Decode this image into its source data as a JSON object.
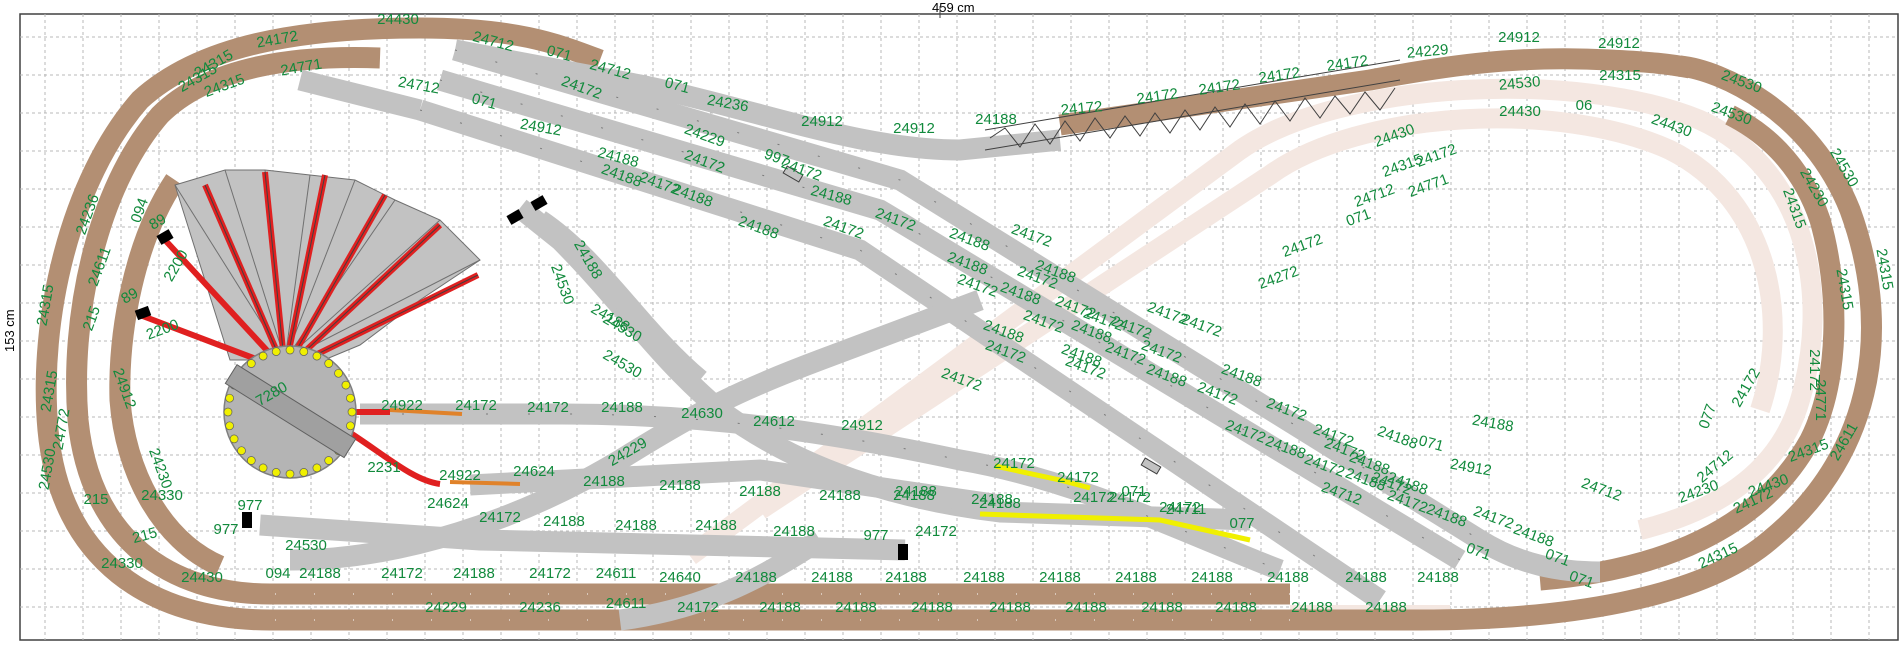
{
  "dimensions": {
    "width_label": "459 cm",
    "height_label": "153 cm"
  },
  "colors": {
    "grid": "#b9b9b9",
    "track_brown": "#b38f73",
    "track_gray": "#c2c2c2",
    "track_ghost": "#f4e7e1",
    "label_green": "#118a3c",
    "rail_red": "#e02020",
    "rail_yellow": "#f0f000",
    "turntable_light": "#b4b4b4"
  },
  "labels": [
    {
      "id": "a1",
      "text": "24430"
    },
    {
      "id": "a2",
      "text": "24712"
    },
    {
      "id": "a3",
      "text": "071"
    },
    {
      "id": "a4",
      "text": "24712"
    },
    {
      "id": "a5",
      "text": "071"
    },
    {
      "id": "a6",
      "text": "24236"
    },
    {
      "id": "a7",
      "text": "24912"
    },
    {
      "id": "a8",
      "text": "24912"
    },
    {
      "id": "a9",
      "text": "24188"
    },
    {
      "id": "a10",
      "text": "24172"
    },
    {
      "id": "a11",
      "text": "24172"
    },
    {
      "id": "a12",
      "text": "24172"
    },
    {
      "id": "a13",
      "text": "24172"
    },
    {
      "id": "a14",
      "text": "24172"
    },
    {
      "id": "a15",
      "text": "24229"
    },
    {
      "id": "a16",
      "text": "24912"
    },
    {
      "id": "a17",
      "text": "24912"
    },
    {
      "id": "a18",
      "text": "24530"
    },
    {
      "id": "a19",
      "text": "24315"
    },
    {
      "id": "a20",
      "text": "24530"
    },
    {
      "id": "a21",
      "text": "24430"
    },
    {
      "id": "a22",
      "text": "06"
    },
    {
      "id": "a23",
      "text": "24430"
    },
    {
      "id": "a24",
      "text": "24530"
    },
    {
      "id": "a25",
      "text": "24530"
    },
    {
      "id": "a26",
      "text": "24230"
    },
    {
      "id": "a27",
      "text": "24315"
    },
    {
      "id": "a28",
      "text": "24315"
    },
    {
      "id": "a29",
      "text": "24315"
    },
    {
      "id": "a30",
      "text": "24172"
    },
    {
      "id": "a31",
      "text": "24771"
    },
    {
      "id": "a32",
      "text": "24315"
    },
    {
      "id": "a33",
      "text": "24430"
    },
    {
      "id": "a34",
      "text": "24172"
    },
    {
      "id": "a35",
      "text": "24315"
    },
    {
      "id": "a36",
      "text": "24230"
    },
    {
      "id": "a37",
      "text": "24712"
    },
    {
      "id": "a38",
      "text": "24611"
    },
    {
      "id": "a39",
      "text": "077"
    },
    {
      "id": "a40",
      "text": "24172"
    },
    {
      "id": "b1",
      "text": "24315"
    },
    {
      "id": "b2",
      "text": "24172"
    },
    {
      "id": "b3",
      "text": "24315"
    },
    {
      "id": "b4",
      "text": "24315"
    },
    {
      "id": "b5",
      "text": "24771"
    },
    {
      "id": "b6",
      "text": "24712"
    },
    {
      "id": "b7",
      "text": "071"
    },
    {
      "id": "b8",
      "text": "24912"
    },
    {
      "id": "b9",
      "text": "24172"
    },
    {
      "id": "b10",
      "text": "24188"
    },
    {
      "id": "b11",
      "text": "24229"
    },
    {
      "id": "b12",
      "text": "997"
    },
    {
      "id": "b13",
      "text": "24188"
    },
    {
      "id": "b14",
      "text": "24172"
    },
    {
      "id": "b15",
      "text": "24172"
    },
    {
      "id": "b16",
      "text": "24188"
    },
    {
      "id": "b17",
      "text": "24188"
    },
    {
      "id": "b18",
      "text": "24172"
    },
    {
      "id": "b19",
      "text": "24188"
    },
    {
      "id": "b20",
      "text": "24172"
    },
    {
      "id": "b21",
      "text": "24172"
    },
    {
      "id": "b22",
      "text": "24188"
    },
    {
      "id": "b23",
      "text": "24172"
    },
    {
      "id": "b24",
      "text": "24188"
    },
    {
      "id": "b25",
      "text": "24172"
    },
    {
      "id": "b26",
      "text": "24188"
    },
    {
      "id": "b27",
      "text": "24172"
    },
    {
      "id": "b28",
      "text": "24172"
    },
    {
      "id": "b29",
      "text": "24188"
    },
    {
      "id": "b30",
      "text": "24172"
    },
    {
      "id": "b31",
      "text": "24172"
    },
    {
      "id": "b32",
      "text": "24188"
    },
    {
      "id": "b33",
      "text": "24172"
    },
    {
      "id": "b34",
      "text": "24188"
    },
    {
      "id": "b35",
      "text": "24172"
    },
    {
      "id": "b36",
      "text": "24188"
    },
    {
      "id": "b37",
      "text": "24172"
    },
    {
      "id": "b38",
      "text": "24188"
    },
    {
      "id": "b39",
      "text": "071"
    },
    {
      "id": "b40",
      "text": "071"
    },
    {
      "id": "b41",
      "text": "24912"
    },
    {
      "id": "b42",
      "text": "24188"
    },
    {
      "id": "b43",
      "text": "24712"
    },
    {
      "id": "b44",
      "text": "24172"
    },
    {
      "id": "b45",
      "text": "24172"
    },
    {
      "id": "b46",
      "text": "071"
    },
    {
      "id": "b47",
      "text": "24188"
    },
    {
      "id": "b48",
      "text": "24712"
    },
    {
      "id": "b49",
      "text": "24188"
    },
    {
      "id": "b50",
      "text": "24172"
    },
    {
      "id": "b51",
      "text": "24188"
    },
    {
      "id": "b52",
      "text": "24172"
    },
    {
      "id": "b53",
      "text": "24172"
    },
    {
      "id": "b54",
      "text": "24172"
    },
    {
      "id": "b55",
      "text": "24172"
    },
    {
      "id": "b56",
      "text": "24172"
    },
    {
      "id": "b57",
      "text": "24188"
    },
    {
      "id": "b58",
      "text": "24172"
    },
    {
      "id": "b59",
      "text": "24172"
    },
    {
      "id": "b60",
      "text": "24188"
    },
    {
      "id": "b61",
      "text": "24172"
    },
    {
      "id": "b62",
      "text": "24172"
    },
    {
      "id": "b63",
      "text": "24188"
    },
    {
      "id": "b64",
      "text": "24172"
    },
    {
      "id": "b65",
      "text": "24172"
    },
    {
      "id": "b66",
      "text": "24188"
    },
    {
      "id": "b67",
      "text": "24188"
    },
    {
      "id": "b68",
      "text": "071"
    },
    {
      "id": "c1",
      "text": "24172"
    },
    {
      "id": "c2",
      "text": "24430"
    },
    {
      "id": "c3",
      "text": "24315"
    },
    {
      "id": "c4",
      "text": "24771"
    },
    {
      "id": "c5",
      "text": "24712"
    },
    {
      "id": "c6",
      "text": "071"
    },
    {
      "id": "c7",
      "text": "24172"
    },
    {
      "id": "c8",
      "text": "24272"
    },
    {
      "id": "c9",
      "text": "24236"
    },
    {
      "id": "c10",
      "text": "094"
    },
    {
      "id": "c11",
      "text": "24611"
    },
    {
      "id": "c12",
      "text": "215"
    },
    {
      "id": "c13",
      "text": "24315"
    },
    {
      "id": "c14",
      "text": "24315"
    },
    {
      "id": "c15",
      "text": "24772"
    },
    {
      "id": "c16",
      "text": "24530"
    },
    {
      "id": "c17",
      "text": "215"
    },
    {
      "id": "c18",
      "text": "215"
    },
    {
      "id": "c19",
      "text": "24330"
    },
    {
      "id": "c20",
      "text": "24430"
    },
    {
      "id": "c21",
      "text": "24912"
    },
    {
      "id": "c22",
      "text": "24230"
    },
    {
      "id": "c23",
      "text": "24330"
    },
    {
      "id": "c24",
      "text": "89"
    },
    {
      "id": "c25",
      "text": "89"
    },
    {
      "id": "c26",
      "text": "2200"
    },
    {
      "id": "c27",
      "text": "2200"
    },
    {
      "id": "c28",
      "text": "7280"
    },
    {
      "id": "c29",
      "text": "977"
    },
    {
      "id": "c30",
      "text": "977"
    },
    {
      "id": "c31",
      "text": "24188"
    },
    {
      "id": "c32",
      "text": "24530"
    },
    {
      "id": "c33",
      "text": "24188"
    },
    {
      "id": "c34",
      "text": "24530"
    },
    {
      "id": "c35",
      "text": "24530"
    },
    {
      "id": "c36",
      "text": "24922"
    },
    {
      "id": "c37",
      "text": "24172"
    },
    {
      "id": "c38",
      "text": "24172"
    },
    {
      "id": "c39",
      "text": "24188"
    },
    {
      "id": "c40",
      "text": "24630"
    },
    {
      "id": "c41",
      "text": "24612"
    },
    {
      "id": "c42",
      "text": "24912"
    },
    {
      "id": "c43",
      "text": "24229"
    },
    {
      "id": "c44",
      "text": "2231"
    },
    {
      "id": "c45",
      "text": "24922"
    },
    {
      "id": "c46",
      "text": "24624"
    },
    {
      "id": "c47",
      "text": "24188"
    },
    {
      "id": "c48",
      "text": "24188"
    },
    {
      "id": "c49",
      "text": "24188"
    },
    {
      "id": "c50",
      "text": "24188"
    },
    {
      "id": "c51",
      "text": "24188"
    },
    {
      "id": "c52",
      "text": "24188"
    },
    {
      "id": "c53",
      "text": "24172"
    },
    {
      "id": "c54",
      "text": "24172"
    },
    {
      "id": "c55",
      "text": "24172"
    },
    {
      "id": "c56",
      "text": "24172"
    },
    {
      "id": "c57",
      "text": "24188"
    },
    {
      "id": "c58",
      "text": "24172"
    },
    {
      "id": "c59",
      "text": "24624"
    },
    {
      "id": "c60",
      "text": "24172"
    },
    {
      "id": "c61",
      "text": "24188"
    },
    {
      "id": "c62",
      "text": "24188"
    },
    {
      "id": "c63",
      "text": "24188"
    },
    {
      "id": "c64",
      "text": "24188"
    },
    {
      "id": "c65",
      "text": "977"
    },
    {
      "id": "c66",
      "text": "24188"
    },
    {
      "id": "c67",
      "text": "24172"
    },
    {
      "id": "c68",
      "text": "071"
    },
    {
      "id": "c69",
      "text": "24711"
    },
    {
      "id": "c70",
      "text": "077"
    },
    {
      "id": "c71",
      "text": "24530"
    },
    {
      "id": "d1",
      "text": "094"
    },
    {
      "id": "d2",
      "text": "24188"
    },
    {
      "id": "d3",
      "text": "24172"
    },
    {
      "id": "d4",
      "text": "24188"
    },
    {
      "id": "d5",
      "text": "24172"
    },
    {
      "id": "d6",
      "text": "24611"
    },
    {
      "id": "d7",
      "text": "24640"
    },
    {
      "id": "d8",
      "text": "24188"
    },
    {
      "id": "d9",
      "text": "24188"
    },
    {
      "id": "d10",
      "text": "24188"
    },
    {
      "id": "d11",
      "text": "24188"
    },
    {
      "id": "d12",
      "text": "24188"
    },
    {
      "id": "d13",
      "text": "24188"
    },
    {
      "id": "d14",
      "text": "24188"
    },
    {
      "id": "d15",
      "text": "24188"
    },
    {
      "id": "d16",
      "text": "24188"
    },
    {
      "id": "d17",
      "text": "24188"
    },
    {
      "id": "d18",
      "text": "24229"
    },
    {
      "id": "d19",
      "text": "24236"
    },
    {
      "id": "d20",
      "text": "24611"
    },
    {
      "id": "d21",
      "text": "24172"
    },
    {
      "id": "d22",
      "text": "24188"
    },
    {
      "id": "d23",
      "text": "24188"
    },
    {
      "id": "d24",
      "text": "24188"
    },
    {
      "id": "d25",
      "text": "24188"
    },
    {
      "id": "d26",
      "text": "24188"
    },
    {
      "id": "d27",
      "text": "24188"
    },
    {
      "id": "d28",
      "text": "24188"
    },
    {
      "id": "d29",
      "text": "24188"
    },
    {
      "id": "d30",
      "text": "24188"
    }
  ]
}
